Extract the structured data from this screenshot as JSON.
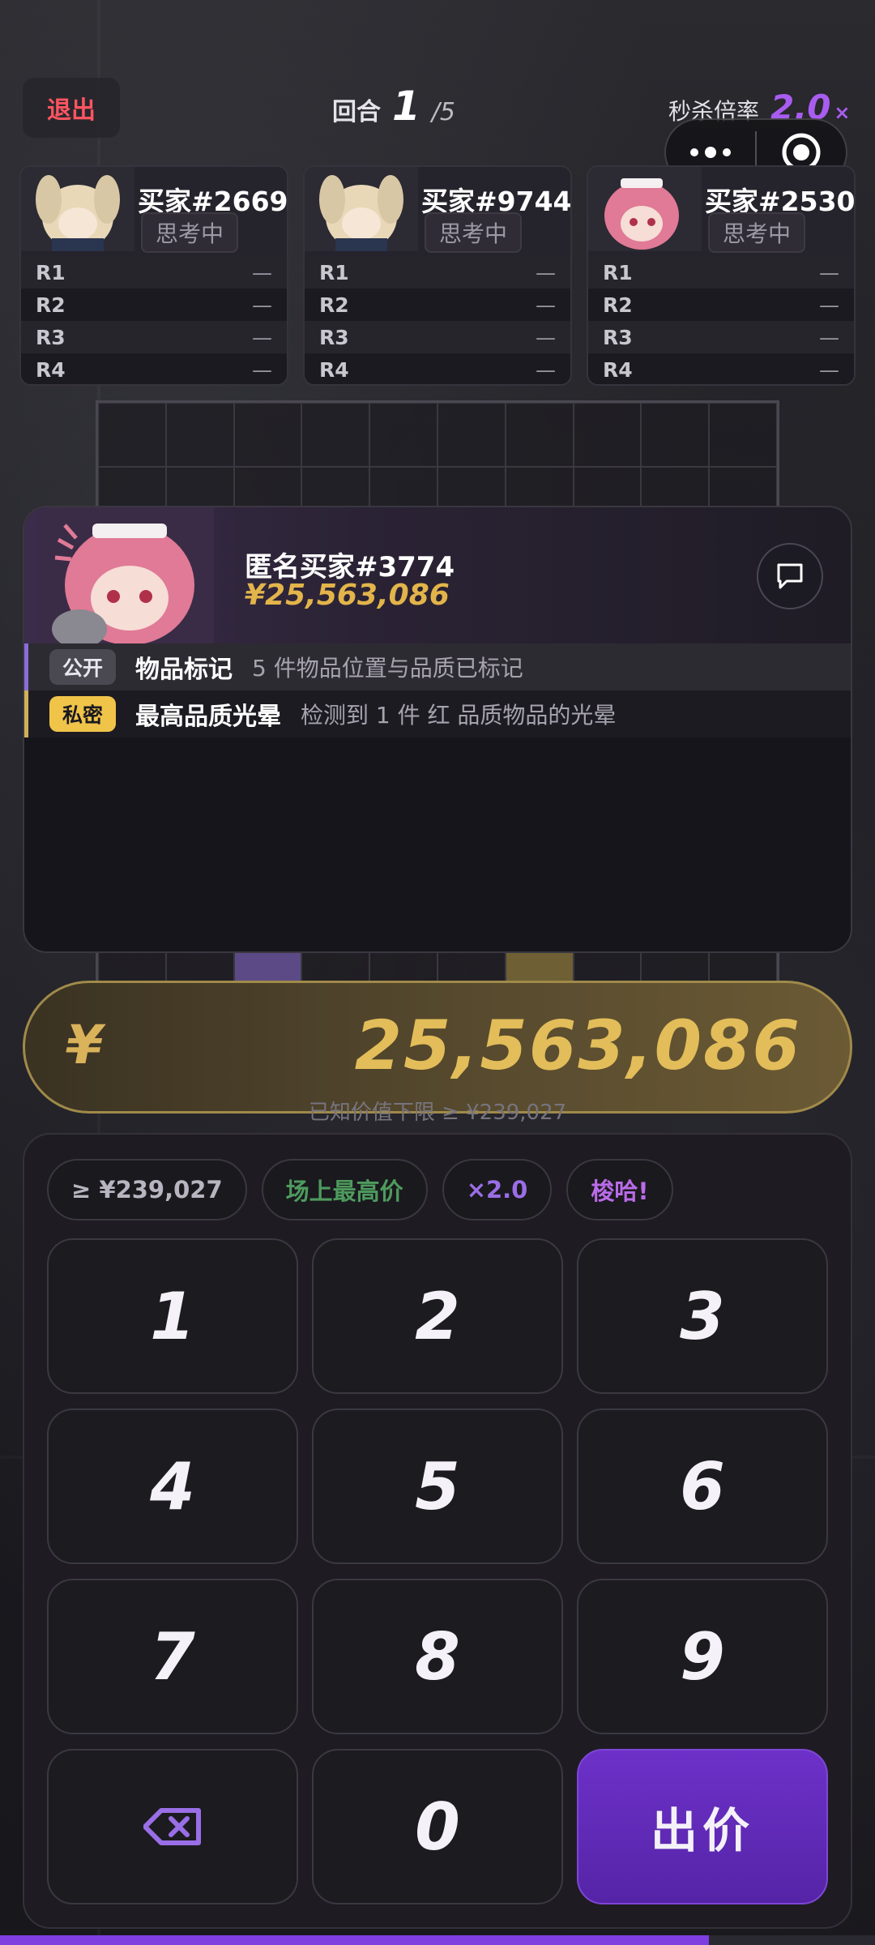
{
  "header": {
    "exit_label": "退出",
    "round_label": "回合",
    "round_current": "1",
    "round_total": "/5",
    "multiplier_label": "秒杀倍率",
    "multiplier_value": "2.0",
    "multiplier_suffix": "×"
  },
  "players": [
    {
      "name": "买家#2669",
      "status": "思考中",
      "rows": [
        {
          "label": "R1",
          "value": "—"
        },
        {
          "label": "R2",
          "value": "—"
        },
        {
          "label": "R3",
          "value": "—"
        },
        {
          "label": "R4",
          "value": "—"
        }
      ]
    },
    {
      "name": "买家#9744",
      "status": "思考中",
      "rows": [
        {
          "label": "R1",
          "value": "—"
        },
        {
          "label": "R2",
          "value": "—"
        },
        {
          "label": "R3",
          "value": "—"
        },
        {
          "label": "R4",
          "value": "—"
        }
      ]
    },
    {
      "name": "买家#2530",
      "status": "思考中",
      "rows": [
        {
          "label": "R1",
          "value": "—"
        },
        {
          "label": "R2",
          "value": "—"
        },
        {
          "label": "R3",
          "value": "—"
        },
        {
          "label": "R4",
          "value": "—"
        }
      ]
    }
  ],
  "info_panel": {
    "buyer_name": "匿名买家#3774",
    "buyer_price": "¥25,563,086",
    "public_tag": "公开",
    "public_title": "物品标记",
    "public_desc": "5 件物品位置与品质已标记",
    "private_tag": "私密",
    "private_title": "最高品质光晕",
    "private_desc": "检测到 1 件 红 品质物品的光晕"
  },
  "bid": {
    "currency": "¥",
    "amount": "25,563,086",
    "hint": "已知价值下限 ≥ ¥239,027"
  },
  "chips": {
    "min": "≥ ¥239,027",
    "top": "场上最高价",
    "x2": "×2.0",
    "showhand": "梭哈!"
  },
  "keys": {
    "k1": "1",
    "k2": "2",
    "k3": "3",
    "k4": "4",
    "k5": "5",
    "k6": "6",
    "k7": "7",
    "k8": "8",
    "k9": "9",
    "k0": "0",
    "backspace": "⌫",
    "submit": "出价"
  },
  "colors": {
    "accent_purple": "#7e3ee0",
    "gold": "#e3bd5a",
    "exit_red": "#ff5560"
  },
  "timer_progress": 0.81
}
